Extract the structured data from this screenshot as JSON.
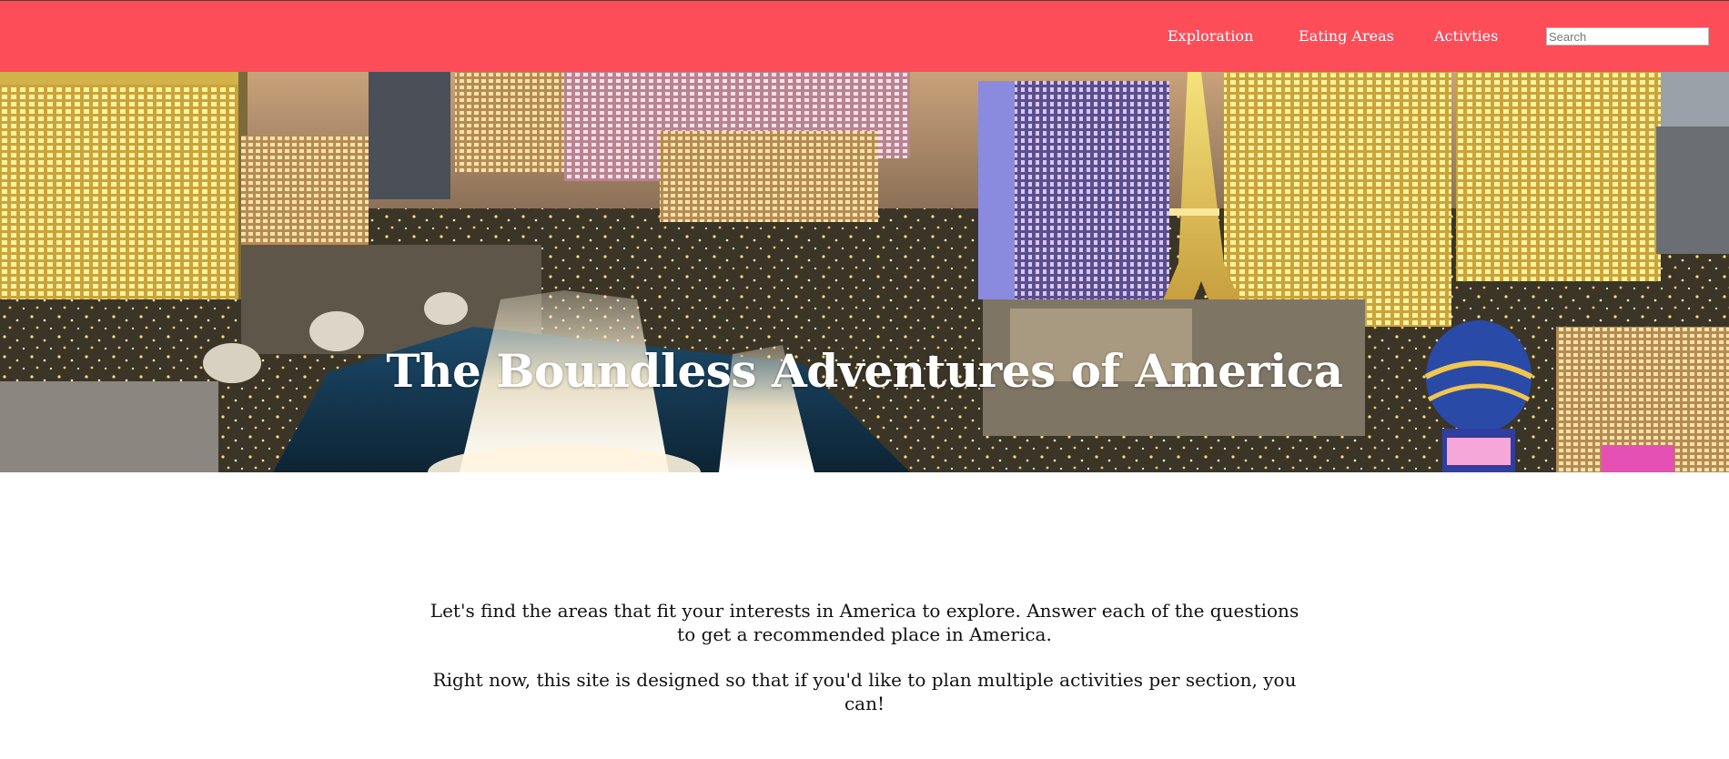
{
  "nav": {
    "links": [
      "Exploration",
      "Eating Areas",
      "Activties"
    ],
    "search_placeholder": "Search"
  },
  "hero": {
    "title": "The Boundless Adventures of America",
    "image": "las-vegas-strip-night-aerial"
  },
  "intro": {
    "paragraph_1": "Let's find the areas that fit your interests in America to explore. Answer each of the questions to get a recommended place in America.",
    "paragraph_2": "Right now, this site is designed so that if you'd like to plan multiple activities per section, you can!"
  },
  "colors": {
    "nav_background": "#fc4d59",
    "nav_text": "#ffffff",
    "body_text": "#111111"
  }
}
